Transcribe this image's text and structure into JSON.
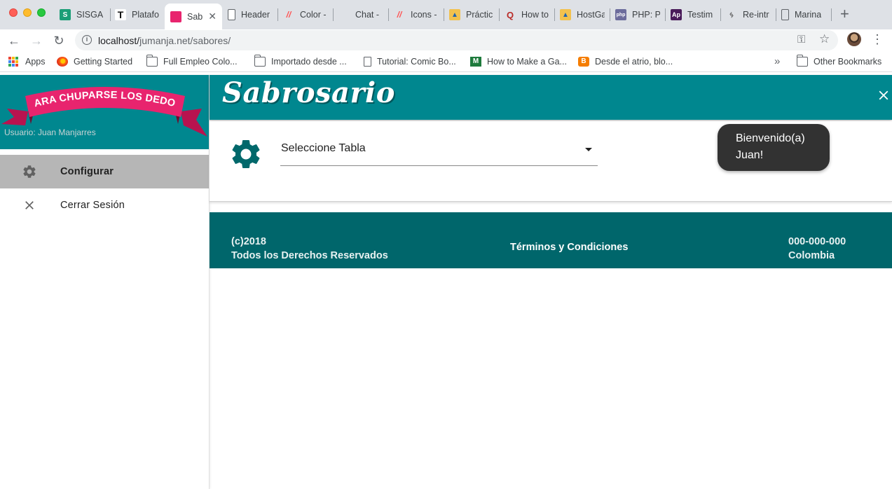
{
  "browser": {
    "tabs": [
      {
        "title": "SISGA",
        "favicon": "sisga-s-icon",
        "color": "#1b9e77"
      },
      {
        "title": "Platafo",
        "favicon": "platform-t-icon",
        "color": "#111111"
      },
      {
        "title": "Sab",
        "favicon": "sabrosario-icon",
        "color": "#e8246e",
        "active": true
      },
      {
        "title": "Header",
        "favicon": "page-icon",
        "color": "#5f6368"
      },
      {
        "title": "Color -",
        "favicon": "material-icon",
        "color": "#ff5252"
      },
      {
        "title": "Chat -",
        "favicon": "blank-icon",
        "color": "#dee1e6"
      },
      {
        "title": "Icons -",
        "favicon": "material-icon",
        "color": "#ff5252"
      },
      {
        "title": "Práctic",
        "favicon": "hostgator-icon",
        "color": "#1f63b0"
      },
      {
        "title": "How to",
        "favicon": "quora-icon",
        "color": "#b92b27"
      },
      {
        "title": "HostGa",
        "favicon": "hostgator-icon",
        "color": "#1f63b0"
      },
      {
        "title": "PHP: P",
        "favicon": "php-icon",
        "color": "#6c6c9c"
      },
      {
        "title": "Testim",
        "favicon": "ap-icon",
        "color": "#4a1b5a"
      },
      {
        "title": "Re-intr",
        "favicon": "code-icon",
        "color": "#555555"
      },
      {
        "title": "Marina",
        "favicon": "page-icon",
        "color": "#5f6368"
      }
    ],
    "url_host": "localhost/",
    "url_path": "jumanja.net/sabores/",
    "bookmarks": [
      {
        "label": "Apps",
        "icon": "apps-grid-icon"
      },
      {
        "label": "Getting Started",
        "icon": "firefox-icon"
      },
      {
        "label": "Full Empleo Colo...",
        "icon": "folder-icon"
      },
      {
        "label": "Importado desde ...",
        "icon": "folder-icon"
      },
      {
        "label": "Tutorial: Comic Bo...",
        "icon": "page-icon"
      },
      {
        "label": "How to Make a Ga...",
        "icon": "green-m-icon"
      },
      {
        "label": "Desde el atrio, blo...",
        "icon": "blogger-icon"
      }
    ],
    "other_bookmarks": "Other Bookmarks",
    "more_bookmarks": "»"
  },
  "sidenav": {
    "banner_text": "PARA CHUPARSE LOS DEDOS",
    "user_label": "Usuario: Juan Manjarres",
    "items": [
      {
        "label": "Configurar",
        "icon": "gear-icon",
        "active": true
      },
      {
        "label": "Cerrar Sesión",
        "icon": "close-icon",
        "active": false
      }
    ]
  },
  "header": {
    "brand": "Sabrosario"
  },
  "main": {
    "select_placeholder": "Seleccione Tabla"
  },
  "toast": {
    "line1": "Bienvenido(a)",
    "line2": "Juan!"
  },
  "footer": {
    "copyright": "(c)2018",
    "rights": "Todos los Derechos Reservados",
    "terms": "Términos y Condiciones",
    "phone": "000-000-000",
    "country": "Colombia"
  },
  "colors": {
    "primary": "#00878f",
    "footer": "#00666b",
    "banner": "#e8246e",
    "active_nav": "#b6b6b6"
  }
}
